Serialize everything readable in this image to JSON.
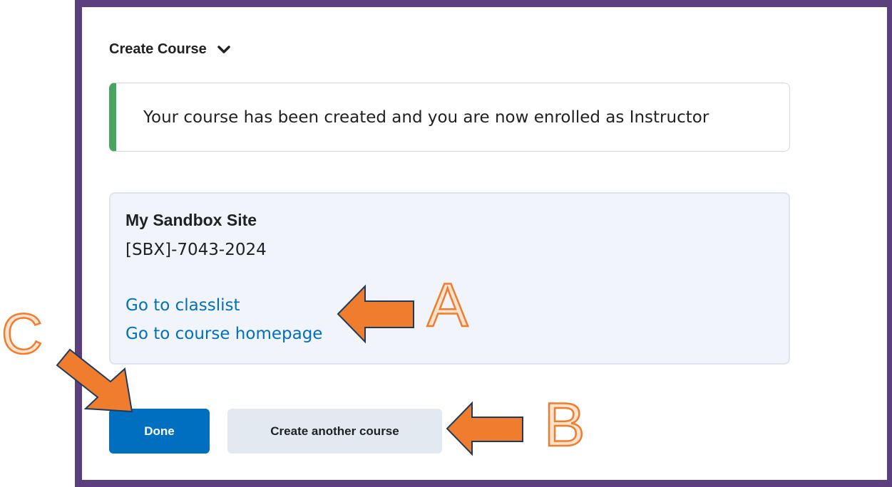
{
  "header": {
    "title": "Create Course"
  },
  "alert": {
    "message": "Your course has been created and you are now enrolled as Instructor"
  },
  "course": {
    "name": "My Sandbox Site",
    "code": "[SBX]-7043-2024",
    "links": [
      "Go to classlist",
      "Go to course homepage"
    ]
  },
  "buttons": {
    "done": "Done",
    "create_another": "Create another course"
  },
  "annotations": {
    "a": "A",
    "b": "B",
    "c": "C"
  },
  "colors": {
    "frame": "#5b3f7e",
    "success_accent": "#46a661",
    "primary_button": "#006fbf",
    "link": "#006fbf",
    "arrow_fill": "#ef7d2d",
    "arrow_outline": "#1f3a5f"
  }
}
